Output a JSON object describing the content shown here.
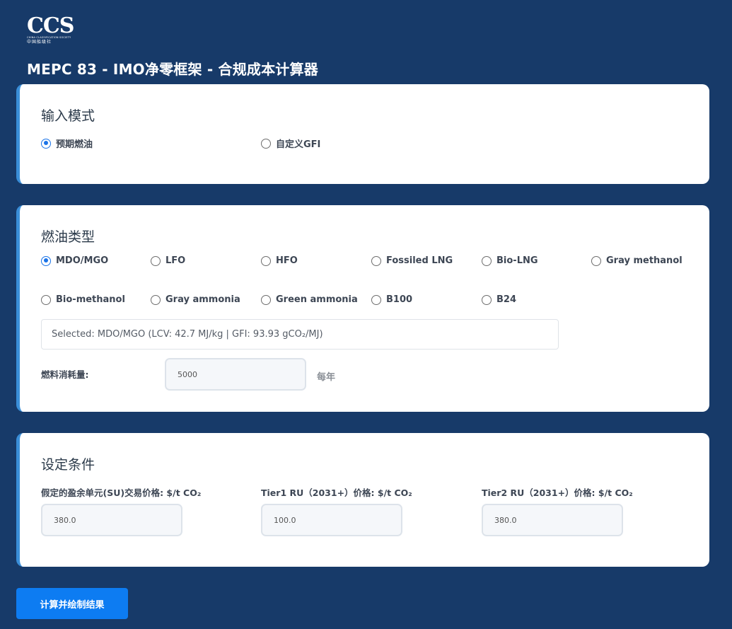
{
  "logo": {
    "mark": "CCS",
    "subtitle": "CHINA CLASSIFICATION SOCIETY",
    "chinese": "中国船级社"
  },
  "page_title": "MEPC 83 - IMO净零框架 - 合规成本计算器",
  "input_mode": {
    "title": "输入模式",
    "options": [
      {
        "label": "预期燃油",
        "checked": true
      },
      {
        "label": "自定义GFI",
        "checked": false
      }
    ]
  },
  "fuel_type": {
    "title": "燃油类型",
    "options": [
      {
        "label": "MDO/MGO",
        "checked": true
      },
      {
        "label": "LFO",
        "checked": false
      },
      {
        "label": "HFO",
        "checked": false
      },
      {
        "label": "Fossiled LNG",
        "checked": false
      },
      {
        "label": "Bio-LNG",
        "checked": false
      },
      {
        "label": "Gray methanol",
        "checked": false
      },
      {
        "label": "Bio-methanol",
        "checked": false
      },
      {
        "label": "Gray ammonia",
        "checked": false
      },
      {
        "label": "Green ammonia",
        "checked": false
      },
      {
        "label": "B100",
        "checked": false
      },
      {
        "label": "B24",
        "checked": false
      }
    ],
    "selected_text": "Selected: MDO/MGO (LCV: 42.7 MJ/kg | GFI: 93.93 gCO₂/MJ)",
    "consumption_label": "燃料消耗量:",
    "consumption_value": "5000",
    "consumption_unit": "每年"
  },
  "conditions": {
    "title": "设定条件",
    "su_label": "假定的盈余单元(SU)交易价格: $/t CO₂",
    "su_value": "380.0",
    "tier1_label": "Tier1 RU（2031+）价格: $/t CO₂",
    "tier1_value": "100.0",
    "tier2_label": "Tier2 RU（2031+）价格: $/t CO₂",
    "tier2_value": "380.0"
  },
  "calculate_button": "计算并绘制结果",
  "colors": {
    "background": "#173a69",
    "card_accent": "#3a8ed8",
    "radio_checked": "#1a73e8",
    "button": "#0d7cf2"
  }
}
